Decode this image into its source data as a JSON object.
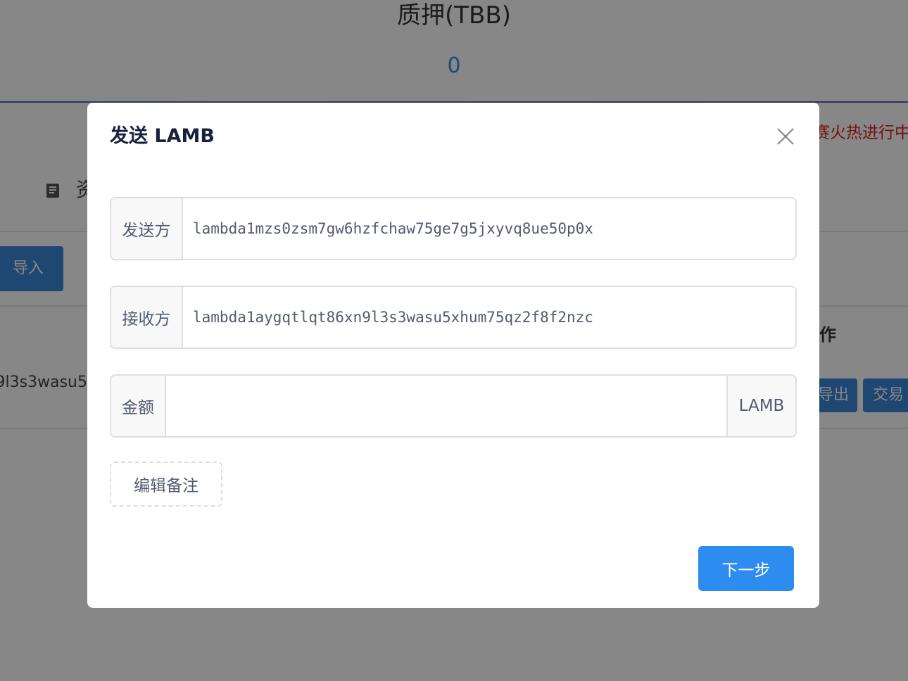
{
  "background": {
    "stat_title": "质押(TBB)",
    "stat_value": "0",
    "notice_text": "赛火热进行中",
    "section_label": "资",
    "import_label": "导入",
    "column_header": "作",
    "address_fragment": "9l3s3wasu5",
    "export_label": "导出",
    "trade_label": "交易"
  },
  "dialog": {
    "title": "发送 LAMB",
    "sender_label": "发送方",
    "sender_value": "lambda1mzs0zsm7gw6hzfchaw75ge7g5jxyvq8ue50p0x",
    "recipient_label": "接收方",
    "recipient_value": "lambda1aygqtlqt86xn9l3s3wasu5xhum75qz2f8f2nzc",
    "amount_label": "金额",
    "amount_value": "",
    "amount_unit": "LAMB",
    "memo_label": "编辑备注",
    "next_label": "下一步"
  },
  "colors": {
    "primary": "#2d8cf0",
    "overlay": "rgba(0,0,0,0.47)",
    "notice": "#e02020"
  }
}
